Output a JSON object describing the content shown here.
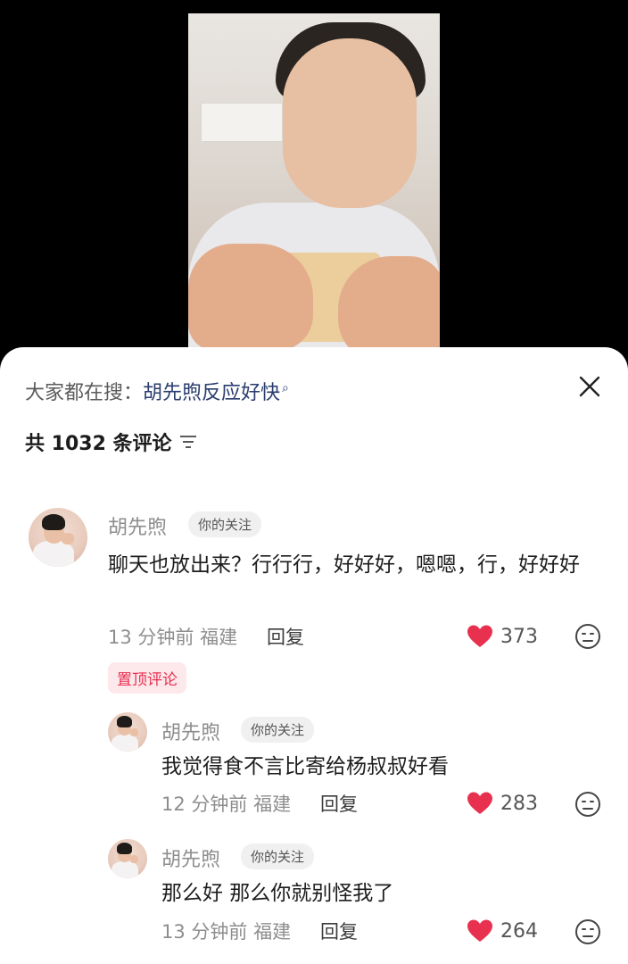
{
  "hot_search": {
    "prefix": "大家都在搜：",
    "query": "胡先煦反应好快",
    "search_icon": "search-icon"
  },
  "comment_count_label": "共 1032 条评论",
  "comments": [
    {
      "name": "胡先煦",
      "badge": "你的关注",
      "text": "聊天也放出来？行行行，好好好，嗯嗯，行，好好好",
      "time_location": "13 分钟前 福建",
      "reply_label": "回复",
      "likes": "373",
      "pinned_label": "置顶评论"
    },
    {
      "name": "胡先煦",
      "badge": "你的关注",
      "text": "我觉得食不言比寄给杨叔叔好看",
      "time_location": "12 分钟前 福建",
      "reply_label": "回复",
      "likes": "283"
    },
    {
      "name": "胡先煦",
      "badge": "你的关注",
      "text": "那么好 那么你就别怪我了",
      "time_location": "13 分钟前 福建",
      "reply_label": "回复",
      "likes": "264"
    }
  ],
  "colors": {
    "like_heart": "#e8314f",
    "hot_query": "#2a3d6e"
  }
}
